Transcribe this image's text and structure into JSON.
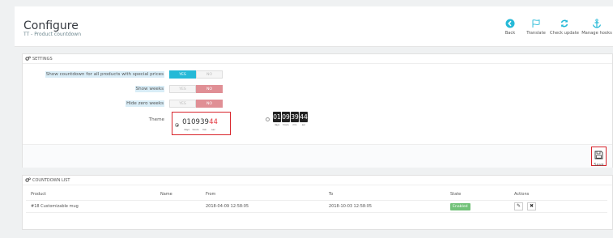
{
  "header": {
    "title": "Configure",
    "subtitle": "TT - Product countdown",
    "toolbar": [
      {
        "label": "Back",
        "icon": "back-circle-arrow-icon"
      },
      {
        "label": "Translate",
        "icon": "flag-icon"
      },
      {
        "label": "Check update",
        "icon": "refresh-icon"
      },
      {
        "label": "Manage hooks",
        "icon": "anchor-icon"
      }
    ]
  },
  "settings": {
    "heading": "SETTINGS",
    "rows": [
      {
        "label": "Show countdown for all products with special prices",
        "yes": "YES",
        "no": "NO",
        "value": "YES"
      },
      {
        "label": "Show weeks",
        "yes": "YES",
        "no": "NO",
        "value": "NO"
      },
      {
        "label": "Hide zero weeks",
        "yes": "YES",
        "no": "NO",
        "value": "NO"
      }
    ],
    "theme": {
      "label": "Theme",
      "selected": 1,
      "theme1": {
        "values": [
          "01",
          "09",
          "39",
          "44"
        ],
        "units": [
          "days",
          "hours",
          "min",
          "sec"
        ]
      },
      "theme2": {
        "values": [
          "01",
          "09",
          "39",
          "44"
        ],
        "units": [
          "days",
          "hours",
          "min",
          "sec"
        ]
      }
    },
    "save_label": "Save"
  },
  "countdown_list": {
    "heading": "COUNTDOWN LIST",
    "columns": [
      "Product",
      "Name",
      "From",
      "To",
      "State",
      "Actions"
    ],
    "rows": [
      {
        "product": "#18 Customizable mug",
        "name": "",
        "from": "2018-04-09 12:58:05",
        "to": "2018-10-03 12:58:05",
        "state": "Enabled"
      }
    ]
  },
  "colors": {
    "accent": "#25b9d7",
    "no_active": "#e08f95",
    "enabled_badge": "#72c279",
    "highlight_border": "#d8232a"
  }
}
